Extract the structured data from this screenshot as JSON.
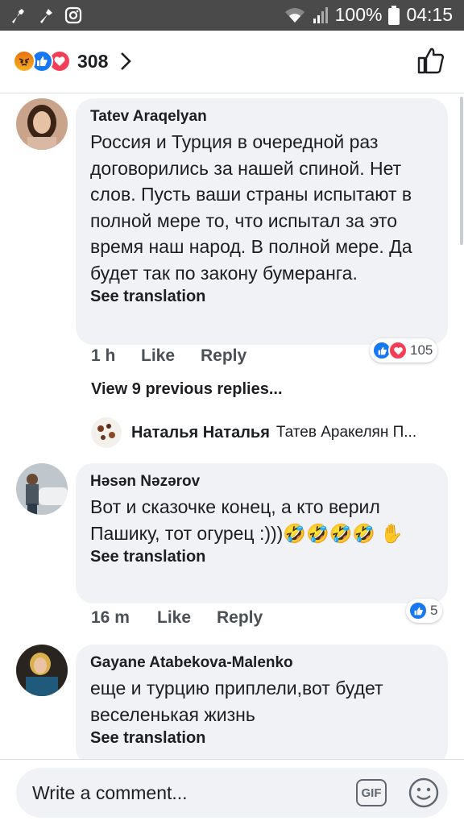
{
  "status_bar": {
    "battery": "100%",
    "time": "04:15"
  },
  "header": {
    "reaction_count": "308"
  },
  "comments": [
    {
      "author": "Tatev Araqelyan",
      "text": "Россия и Турция в очередной раз договорились за нашей спиной. Нет слов. Пусть ваши страны испытают в полной мере то, что испытал за это время наш народ. В полной мере. Да будет так по закону бумеранга.",
      "see_translation": "See translation",
      "time": "1 h",
      "like": "Like",
      "reply": "Reply",
      "reaction_count": "105"
    },
    {
      "author": "Həsən Nəzərov",
      "text": "Вот и сказочке конец, а кто верил Пашику, тот огурец :)))🤣🤣🤣🤣 ✋",
      "see_translation": "See translation",
      "time": "16 m",
      "like": "Like",
      "reply": "Reply",
      "reaction_count": "5"
    },
    {
      "author": "Gayane Atabekova-Malenko",
      "text": "еще и турцию приплели,вот будет веселенькая жизнь",
      "see_translation": "See translation"
    }
  ],
  "view_previous": "View 9 previous replies...",
  "reply_preview": {
    "name": "Наталья Наталья",
    "text": "Татев Аракелян П..."
  },
  "composer": {
    "placeholder": "Write a comment...",
    "gif_label": "GIF"
  },
  "colors": {
    "like_blue": "#1877f2",
    "love_red": "#f33e58",
    "bubble_bg": "#f0f2f5"
  },
  "icons": [
    "wrench-icon",
    "hammer-icon",
    "instagram-icon",
    "wifi-icon",
    "signal-icon",
    "battery-icon",
    "chevron-right-icon",
    "like-thumb-icon",
    "gif-icon",
    "emoji-icon"
  ]
}
